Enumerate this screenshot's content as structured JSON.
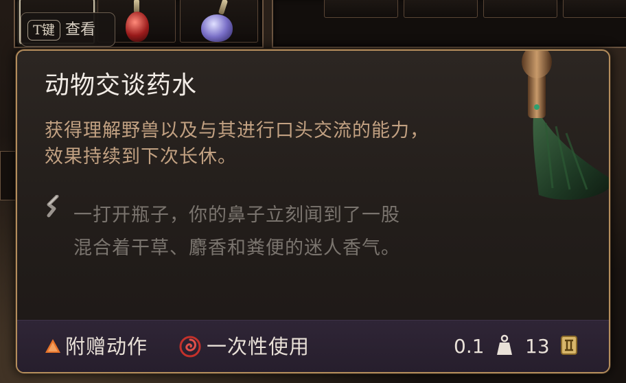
{
  "key_hint": {
    "key": "T键",
    "label": "查看"
  },
  "item": {
    "name": "动物交谈药水",
    "description": "获得理解野兽以及与其进行口头交流的能力，效果持续到下次长休。",
    "flavor": "一打开瓶子，你的鼻子立刻闻到了一股混合着干草、麝香和粪便的迷人香气。",
    "flavor_icon": "quill-icon",
    "tags": [
      {
        "icon": "bonus-action-triangle-icon",
        "label": "附赠动作",
        "color": "#e8742a"
      },
      {
        "icon": "spiral-consumable-icon",
        "label": "一次性使用",
        "color": "#c4312b"
      }
    ],
    "weight": {
      "value": "0.1",
      "icon": "weight-icon"
    },
    "value": {
      "value": "13",
      "icon": "gold-coin-icon"
    }
  },
  "colors": {
    "border_gold": "#b48d5c",
    "description_text": "#c2a182",
    "flavor_text": "#7a746e",
    "bottom_bar": "#2f2536"
  }
}
